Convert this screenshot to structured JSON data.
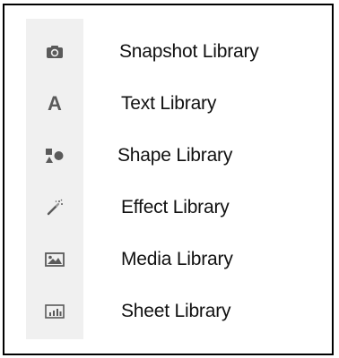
{
  "menu": {
    "items": [
      {
        "label": "Snapshot Library",
        "icon": "camera-icon"
      },
      {
        "label": "Text Library",
        "icon": "text-icon",
        "glyph": "A"
      },
      {
        "label": "Shape Library",
        "icon": "shapes-icon"
      },
      {
        "label": "Effect Library",
        "icon": "magic-wand-icon"
      },
      {
        "label": "Media Library",
        "icon": "image-icon"
      },
      {
        "label": "Sheet Library",
        "icon": "chart-sheet-icon"
      }
    ]
  },
  "colors": {
    "icon_gray": "#5a5a5a",
    "strip_background": "#f0f0f0",
    "frame_border": "#000000",
    "text": "#111111"
  }
}
